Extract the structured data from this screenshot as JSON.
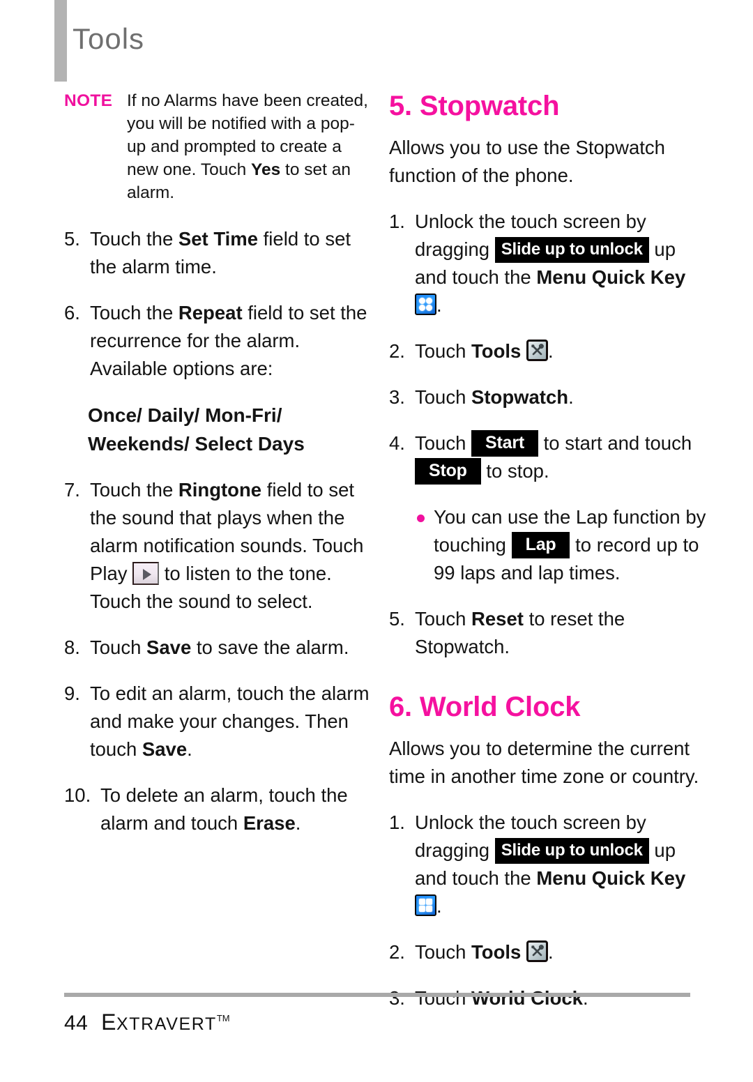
{
  "header": {
    "title": "Tools"
  },
  "note": {
    "label": "NOTE",
    "line1": "If no Alarms have been created,",
    "line2": "you will be notified with a pop-up",
    "line3": "and prompted to create a new",
    "line4_pre": "one. Touch ",
    "line4_bold": "Yes",
    "line4_post": " to set an alarm."
  },
  "left_column": {
    "item5": {
      "num": "5.",
      "pre": "Touch the ",
      "bold": "Set Time",
      "post": " field to set the alarm time."
    },
    "item6": {
      "num": "6.",
      "pre": "Touch the ",
      "bold": "Repeat",
      "post": " field to set the recurrence for the alarm. Available options are:"
    },
    "options": "Once/ Daily/ Mon-Fri/ Weekends/ Select Days",
    "item7": {
      "num": "7.",
      "pre": "Touch the ",
      "bold": "Ringtone",
      "mid": " field to set the sound that plays when the alarm notification sounds. Touch Play ",
      "icon": "play-icon",
      "post": " to listen to the tone. Touch the sound to select."
    },
    "item8": {
      "num": "8.",
      "pre": "Touch ",
      "bold": "Save",
      "post": " to save the alarm."
    },
    "item9": {
      "num": "9.",
      "pre": "To edit an alarm, touch the alarm and make your changes. Then touch ",
      "bold": "Save",
      "post": "."
    },
    "item10": {
      "num": "10.",
      "pre": "To delete an alarm, touch the alarm and touch ",
      "bold": "Erase",
      "post": "."
    }
  },
  "right_column": {
    "stopwatch": {
      "heading": "5. Stopwatch",
      "lead": "Allows you to use the Stopwatch function of the phone.",
      "step1": {
        "num": "1.",
        "pre": "Unlock the touch screen by dragging ",
        "badge": "Slide up to unlock",
        "mid": " up and touch the ",
        "bold": "Menu Quick Key",
        "icon": "menu-quick-key-icon",
        "post": "."
      },
      "step2": {
        "num": "2.",
        "pre": "Touch ",
        "bold": "Tools",
        "icon": "tools-icon",
        "post": "."
      },
      "step3": {
        "num": "3.",
        "pre": "Touch ",
        "bold": "Stopwatch",
        "post": "."
      },
      "step4": {
        "num": "4.",
        "pre": "Touch ",
        "badge_start": "Start",
        "mid": " to start and touch ",
        "badge_stop": "Stop",
        "post": " to stop."
      },
      "lap_bullet": {
        "pre": "You can use the Lap function by touching ",
        "badge": "Lap",
        "post": " to record up to 99 laps and lap times."
      },
      "step5": {
        "num": "5.",
        "pre": "Touch ",
        "bold": "Reset",
        "post": " to reset the Stopwatch."
      }
    },
    "world_clock": {
      "heading": "6. World Clock",
      "lead": "Allows you to determine the current time in another time zone or country.",
      "step1": {
        "num": "1.",
        "pre": "Unlock the touch screen by dragging ",
        "badge": "Slide up to unlock",
        "mid": " up and touch the ",
        "bold": "Menu Quick Key",
        "icon": "menu-quick-key-icon",
        "post": "."
      },
      "step2": {
        "num": "2.",
        "pre": "Touch ",
        "bold": "Tools",
        "icon": "tools-icon",
        "post": "."
      },
      "step3": {
        "num": "3.",
        "pre": "Touch ",
        "bold": "World Clock",
        "post": "."
      }
    }
  },
  "footer": {
    "page": "44",
    "brand_cap": "E",
    "brand_rest": "XTRAVERT",
    "tm": "TM"
  },
  "colors": {
    "accent_magenta": "#F0119E",
    "header_gray": "#B3B3B3",
    "rule_gray": "#A9A9A9",
    "badge_black": "#000000",
    "menu_icon_blue": "#1D86F5"
  }
}
